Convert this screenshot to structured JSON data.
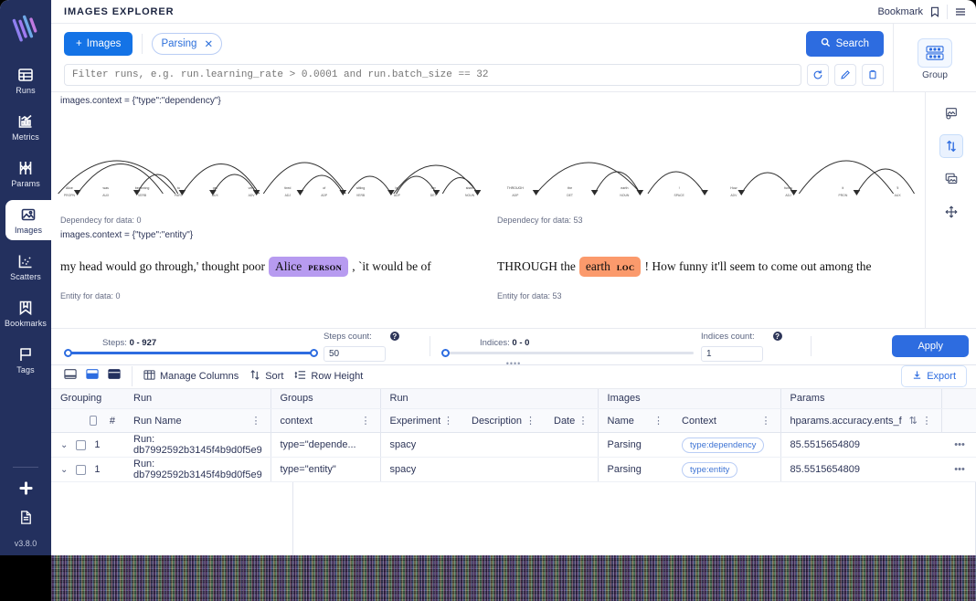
{
  "sidebar": {
    "logo_name": "aim-logo",
    "items": [
      {
        "label": "Runs",
        "icon": "table-icon",
        "active": false
      },
      {
        "label": "Metrics",
        "icon": "chart-icon",
        "active": false
      },
      {
        "label": "Params",
        "icon": "params-icon",
        "active": false
      },
      {
        "label": "Images",
        "icon": "image-icon",
        "active": true
      },
      {
        "label": "Scatters",
        "icon": "scatter-icon",
        "active": false
      },
      {
        "label": "Bookmarks",
        "icon": "bookmark-icon",
        "active": false
      },
      {
        "label": "Tags",
        "icon": "flag-icon",
        "active": false
      }
    ],
    "bottom": [
      {
        "label": "slack-icon"
      },
      {
        "label": "docs-icon"
      }
    ],
    "version": "v3.8.0"
  },
  "topbar": {
    "title": "IMAGES EXPLORER",
    "bookmark_label": "Bookmark",
    "bookmark_icon": "bookmark-icon",
    "menu_icon": "hamburger-menu-icon"
  },
  "controls": {
    "images_button": "Images",
    "plus_icon": "plus-icon",
    "chip": {
      "label": "Parsing",
      "close_icon": "close-icon"
    },
    "search_button": "Search",
    "search_icon": "search-icon",
    "filter": {
      "value": "",
      "placeholder": "Filter runs, e.g. run.learning_rate > 0.0001 and run.batch_size == 32"
    },
    "side_buttons": [
      {
        "name": "reset-icon"
      },
      {
        "name": "edit-icon"
      },
      {
        "name": "copy-icon"
      }
    ],
    "group": {
      "label": "Group",
      "icon": "group-icon"
    }
  },
  "viz_toolbar": {
    "buttons": [
      {
        "name": "settings-image-icon",
        "selected": false
      },
      {
        "name": "sort-arrows-icon",
        "selected": true
      },
      {
        "name": "stack-images-icon",
        "selected": false
      },
      {
        "name": "move-icon",
        "selected": false
      }
    ]
  },
  "visualization": {
    "dependency": {
      "context_label": "images.context = {\"type\":\"dependency\"}",
      "left": {
        "caption": "Dependecy for data: 0",
        "tokens": [
          {
            "word": "Alice",
            "pos": "PROPN"
          },
          {
            "word": "was",
            "pos": "AUX"
          },
          {
            "word": "beginning",
            "pos": "VERB"
          },
          {
            "word": "to",
            "pos": "PART"
          },
          {
            "word": "get",
            "pos": "AUX"
          },
          {
            "word": "very",
            "pos": "ADV"
          },
          {
            "word": "tired",
            "pos": "ADJ"
          },
          {
            "word": "of",
            "pos": "ADP"
          },
          {
            "word": "sitting",
            "pos": "VERB"
          },
          {
            "word": "by",
            "pos": "ADP"
          },
          {
            "word": "her",
            "pos": "DET"
          },
          {
            "word": "sister",
            "pos": "NOUN"
          }
        ]
      },
      "right": {
        "caption": "Dependecy for data: 53",
        "tokens": [
          {
            "word": "THROUGH",
            "pos": "ADP"
          },
          {
            "word": "the",
            "pos": "DET"
          },
          {
            "word": "earth",
            "pos": "NOUN"
          },
          {
            "word": "!",
            "pos": "SPACE"
          },
          {
            "word": "How",
            "pos": "ADV"
          },
          {
            "word": "funny",
            "pos": "ADJ"
          },
          {
            "word": "it",
            "pos": "PRON"
          },
          {
            "word": "'ll",
            "pos": "AUX"
          }
        ]
      }
    },
    "entity": {
      "context_label": "images.context = {\"type\":\"entity\"}",
      "left": {
        "caption": "Entity for data: 0",
        "before": "my head would go through,' thought poor",
        "entity_text": "Alice",
        "entity_label": "PERSON",
        "entity_color": "#b79bf0",
        "after": ", `it would be of"
      },
      "right": {
        "caption": "Entity for data: 53",
        "before": "THROUGH the",
        "entity_text": "earth",
        "entity_label": "LOC",
        "entity_color": "#fb9a6c",
        "after": "! How funny it'll seem to come out among the"
      }
    }
  },
  "sliders": {
    "steps": {
      "title_prefix": "Steps:",
      "range": "0 - 927",
      "left_pct": 0,
      "right_pct": 100
    },
    "steps_count": {
      "label": "Steps count:",
      "value": "50",
      "help": "?"
    },
    "indices": {
      "title_prefix": "Indices:",
      "range": "0 - 0",
      "left_pct": 0,
      "right_pct": 0
    },
    "indices_count": {
      "label": "Indices count:",
      "value": "1",
      "help": "?"
    },
    "apply_button": "Apply"
  },
  "table_toolbar": {
    "mode_icons": [
      "panel-bottom-icon",
      "panel-split-icon",
      "panel-full-icon"
    ],
    "manage_columns": "Manage Columns",
    "manage_columns_icon": "columns-icon",
    "sort": "Sort",
    "sort_icon": "sort-icon",
    "row_height": "Row Height",
    "row_height_icon": "row-height-icon",
    "export": "Export",
    "export_icon": "download-icon"
  },
  "table": {
    "group_headers": [
      {
        "label": "Grouping",
        "span": 1
      },
      {
        "label": "Run",
        "span": 1
      },
      {
        "label": "Groups",
        "span": 1
      },
      {
        "label": "Run",
        "span": 3
      },
      {
        "label": "Images",
        "span": 2
      },
      {
        "label": "Params",
        "span": 1
      },
      {
        "label": "",
        "span": 1
      }
    ],
    "columns": [
      {
        "label": "#",
        "menu": false
      },
      {
        "label": "Run Name",
        "menu": true
      },
      {
        "label": "context",
        "menu": true
      },
      {
        "label": "Experiment",
        "menu": true
      },
      {
        "label": "Description",
        "menu": true
      },
      {
        "label": "Date",
        "menu": true
      },
      {
        "label": "Name",
        "menu": true
      },
      {
        "label": "Context",
        "menu": true
      },
      {
        "label": "hparams.accuracy.ents_f",
        "menu": true,
        "sortable": true
      },
      {
        "label": "",
        "menu": false
      }
    ],
    "rows": [
      {
        "expand_icon": "chevron-down-icon",
        "index": "1",
        "run_name": "Run: db7992592b3145f4b9d0f5e9",
        "context": "type=\"depende...",
        "experiment": "spacy",
        "description": "",
        "date": "",
        "image_name": "Parsing",
        "image_context": "type:dependency",
        "param_value": "85.5515654809",
        "actions_icon": "more-horizontal-icon"
      },
      {
        "expand_icon": "chevron-down-icon",
        "index": "1",
        "run_name": "Run: db7992592b3145f4b9d0f5e9",
        "context": "type=\"entity\"",
        "experiment": "spacy",
        "description": "",
        "date": "",
        "image_name": "Parsing",
        "image_context": "type:entity",
        "param_value": "85.5515654809",
        "actions_icon": "more-horizontal-icon"
      }
    ]
  },
  "colors": {
    "accent": "#2d6ce0",
    "sidebar": "#23305e",
    "person_entity": "#b79bf0",
    "loc_entity": "#fb9a6c"
  }
}
